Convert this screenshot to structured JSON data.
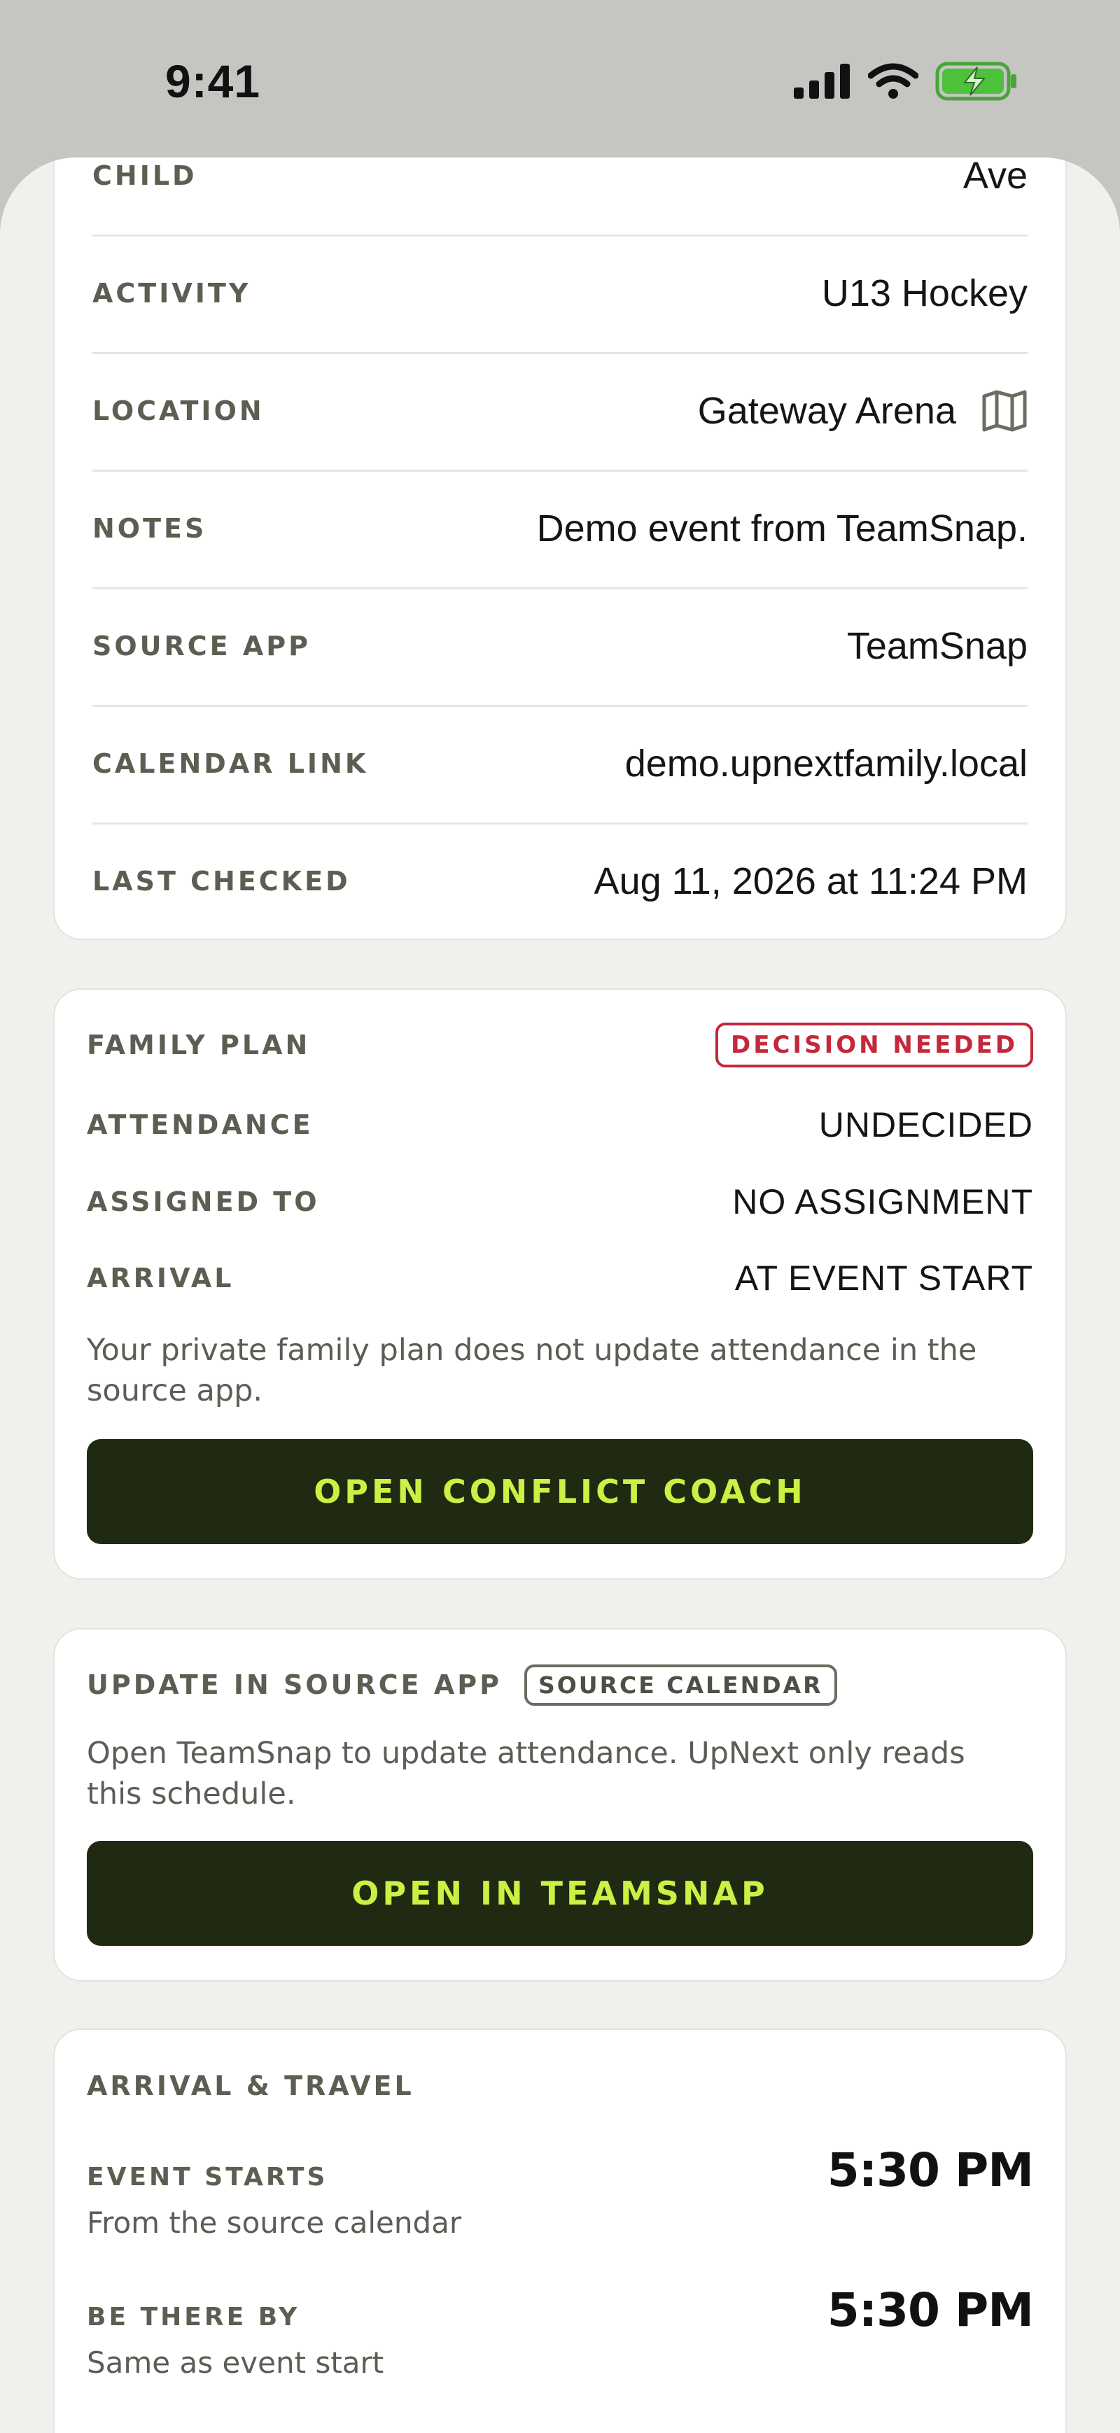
{
  "status_bar": {
    "time": "9:41"
  },
  "details": {
    "rows": [
      {
        "label": "CHILD",
        "value": "Ave"
      },
      {
        "label": "ACTIVITY",
        "value": "U13 Hockey"
      },
      {
        "label": "LOCATION",
        "value": "Gateway Arena",
        "icon": "map-icon"
      },
      {
        "label": "NOTES",
        "value": "Demo event from TeamSnap."
      },
      {
        "label": "SOURCE APP",
        "value": "TeamSnap"
      },
      {
        "label": "CALENDAR LINK",
        "value": "demo.upnextfamily.local"
      },
      {
        "label": "LAST CHECKED",
        "value": "Aug 11, 2026 at 11:24 PM"
      }
    ]
  },
  "family_plan": {
    "title": "FAMILY PLAN",
    "badge": "DECISION NEEDED",
    "rows": [
      {
        "label": "ATTENDANCE",
        "value": "UNDECIDED"
      },
      {
        "label": "ASSIGNED TO",
        "value": "NO ASSIGNMENT"
      },
      {
        "label": "ARRIVAL",
        "value": "AT EVENT START"
      }
    ],
    "note": "Your private family plan does not update attendance in the source app.",
    "button": "OPEN CONFLICT COACH"
  },
  "source_app": {
    "title": "UPDATE IN SOURCE APP",
    "badge": "SOURCE CALENDAR",
    "note": "Open TeamSnap to update attendance. UpNext only reads this schedule.",
    "button": "OPEN IN TEAMSNAP"
  },
  "arrival": {
    "title": "ARRIVAL & TRAVEL",
    "items": [
      {
        "label": "EVENT STARTS",
        "sub": "From the source calendar",
        "time": "5:30 PM"
      },
      {
        "label": "BE THERE BY",
        "sub": "Same as event start",
        "time": "5:30 PM"
      }
    ]
  },
  "colors": {
    "accent": "#ccf044",
    "dark_button": "#202a13",
    "danger": "#c4283a",
    "background": "#f0f0ec"
  }
}
